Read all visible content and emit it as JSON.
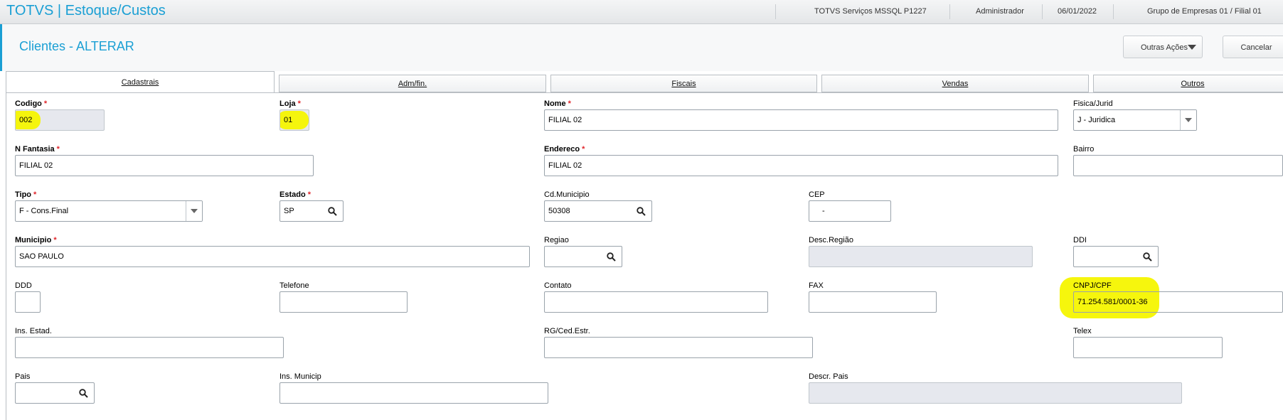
{
  "app": {
    "title": "TOTVS | Estoque/Custos",
    "environment": "TOTVS Serviços MSSQL P1227",
    "user": "Administrador",
    "date": "06/01/2022",
    "company": "Grupo de Empresas 01 / Filial 01"
  },
  "page": {
    "title": "Clientes - ALTERAR",
    "actions": {
      "more_label": "Outras Ações",
      "cancel_label": "Cancelar"
    }
  },
  "tabs": [
    "Cadastrais",
    "Adm/fin.",
    "Fiscais",
    "Vendas",
    "Outros"
  ],
  "form": {
    "codigo": {
      "label": "Codigo",
      "value": "002"
    },
    "loja": {
      "label": "Loja",
      "value": "01"
    },
    "nome": {
      "label": "Nome",
      "value": "FILIAL 02"
    },
    "fisica_jurid": {
      "label": "Fisica/Jurid",
      "value": "J - Juridica"
    },
    "n_fantasia": {
      "label": "N Fantasia",
      "value": "FILIAL 02"
    },
    "endereco": {
      "label": "Endereco",
      "value": "FILIAL 02"
    },
    "bairro": {
      "label": "Bairro",
      "value": ""
    },
    "tipo": {
      "label": "Tipo",
      "value": "F - Cons.Final"
    },
    "estado": {
      "label": "Estado",
      "value": "SP"
    },
    "cd_municipio": {
      "label": "Cd.Municipio",
      "value": "50308"
    },
    "cep": {
      "label": "CEP",
      "value": "-"
    },
    "municipio": {
      "label": "Municipio",
      "value": "SAO PAULO"
    },
    "regiao": {
      "label": "Regiao",
      "value": ""
    },
    "desc_regiao": {
      "label": "Desc.Região",
      "value": ""
    },
    "ddi": {
      "label": "DDI",
      "value": ""
    },
    "ddd": {
      "label": "DDD",
      "value": ""
    },
    "telefone": {
      "label": "Telefone",
      "value": ""
    },
    "contato": {
      "label": "Contato",
      "value": ""
    },
    "fax": {
      "label": "FAX",
      "value": ""
    },
    "cnpj_cpf": {
      "label": "CNPJ/CPF",
      "value": "71.254.581/0001-36"
    },
    "ins_estad": {
      "label": "Ins. Estad.",
      "value": ""
    },
    "rg_ced_estr": {
      "label": "RG/Ced.Estr.",
      "value": ""
    },
    "telex": {
      "label": "Telex",
      "value": ""
    },
    "pais": {
      "label": "Pais",
      "value": ""
    },
    "ins_municip": {
      "label": "Ins. Municip",
      "value": ""
    },
    "descr_pais": {
      "label": "Descr. Pais",
      "value": ""
    },
    "required_marker": "*"
  },
  "colors": {
    "accent": "#1a9fd4",
    "required": "#e0262b",
    "highlight": "#f5f500",
    "readonly_bg": "#e6e8ee"
  },
  "icons": {
    "lookup": "search-icon",
    "dropdown": "chevron-down-icon"
  }
}
